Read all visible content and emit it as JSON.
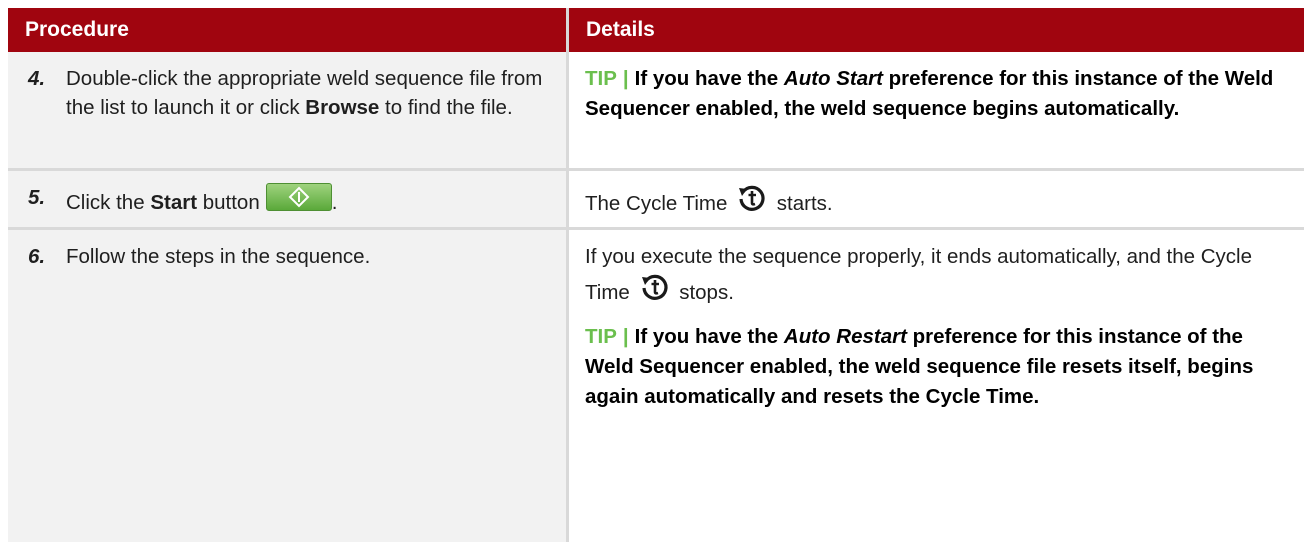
{
  "header": {
    "procedure": "Procedure",
    "details": "Details"
  },
  "rows": [
    {
      "num": "4.",
      "procedure": {
        "text1": "Double-click the appropriate weld sequence file from the list to launch it or click ",
        "bold": "Browse",
        "text2": " to find the file."
      },
      "details": {
        "tip_label": "TIP",
        "tip_sep": "|",
        "t1": "If you have the ",
        "ital": "Auto Start",
        "t2": " preference for this instance of the Weld Sequencer enabled, the weld sequence begins automatically."
      }
    },
    {
      "num": "5.",
      "procedure": {
        "text1": "Click the ",
        "bold": "Start",
        "text2": " button",
        "end": "."
      },
      "details": {
        "t1": "The Cycle Time ",
        "t2": " starts."
      }
    },
    {
      "num": "6.",
      "procedure": {
        "text1": "Follow the steps in the sequence."
      },
      "details": {
        "p1a": "If you execute the sequence properly, it ends automatically, and the Cycle Time ",
        "p1b": " stops.",
        "tip_label": "TIP",
        "tip_sep": "|",
        "t1": "If you have the ",
        "ital": "Auto Restart",
        "t2": " preference for this instance of the Weld Sequencer enabled, the weld sequence file resets itself, begins again automatically and resets the Cycle Time."
      }
    }
  ],
  "icons": {
    "start": "start-diamond-icon",
    "cycle": "cycle-time-icon"
  },
  "colors": {
    "header_bg": "#a0050f",
    "tip": "#6bbf4e",
    "left_bg": "#f2f2f2"
  }
}
